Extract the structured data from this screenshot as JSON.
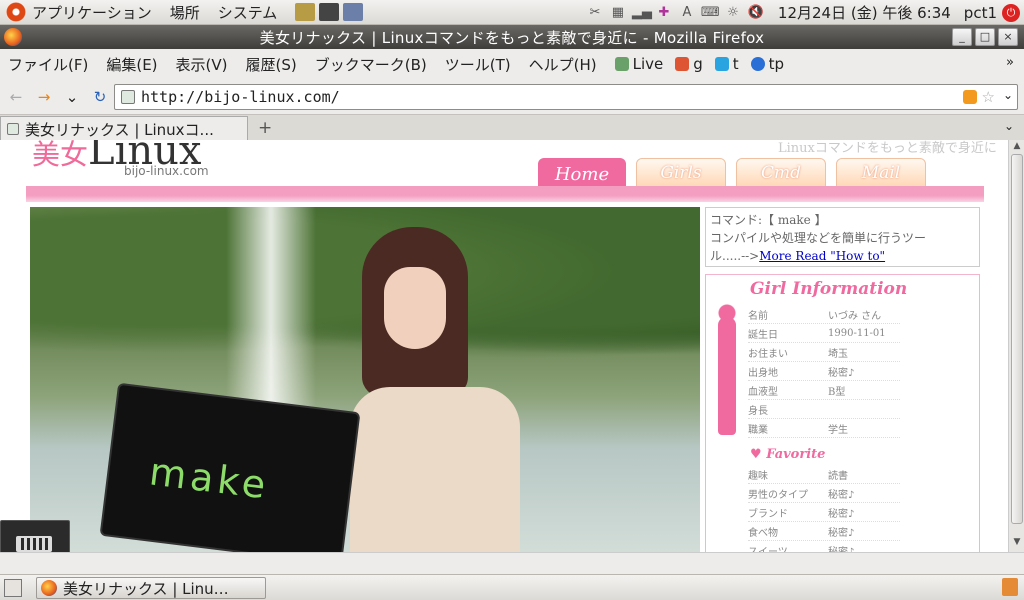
{
  "top_panel": {
    "menus": [
      "アプリケーション",
      "場所",
      "システム"
    ],
    "clock": "12月24日 (金) 午後 6:34",
    "user": "pct1"
  },
  "window": {
    "title": "美女リナックス | Linuxコマンドをもっと素敵で身近に - Mozilla Firefox",
    "buttons": [
      "_",
      "□",
      "×"
    ]
  },
  "menubar": {
    "items": [
      "ファイル(F)",
      "編集(E)",
      "表示(V)",
      "履歴(S)",
      "ブックマーク(B)",
      "ツール(T)",
      "ヘルプ(H)"
    ],
    "bookmarks": [
      {
        "label": "Live",
        "color": "#6aa06a"
      },
      {
        "label": "g",
        "color": "#d53"
      },
      {
        "label": "t",
        "color": "#2aa4e0"
      },
      {
        "label": "tp",
        "color": "#2a6fd6"
      }
    ],
    "more": "»"
  },
  "navbar": {
    "back": "←",
    "forward": "→",
    "history_drop": "⌄",
    "reload": "↻",
    "url": "http://bijo-linux.com/"
  },
  "tabbar": {
    "tab_label": "美女リナックス | Linuxコ...",
    "new_tab": "+",
    "list": "⌄"
  },
  "site": {
    "logo_main": "Linux",
    "logo_kanji": "美女",
    "logo_sub": "bijo-linux.com",
    "tagline": "Linuxコマンドをもっと素敵で身近に",
    "nav": [
      "Home",
      "Girls",
      "Cmd",
      "Mail"
    ],
    "board_text": "make",
    "command_box": {
      "line1": "コマンド:【 make 】",
      "line2": "コンパイルや処理などを簡単に行うツー",
      "line3": "ル.....-->",
      "link": "More Read \"How to\""
    },
    "info_title": "Girl Information",
    "info_rows": [
      {
        "k": "名前",
        "v": "いづみ さん"
      },
      {
        "k": "誕生日",
        "v": "1990-11-01"
      },
      {
        "k": "お住まい",
        "v": "埼玉"
      },
      {
        "k": "出身地",
        "v": "秘密♪"
      },
      {
        "k": "血液型",
        "v": "B型"
      },
      {
        "k": "身長",
        "v": ""
      },
      {
        "k": "職業",
        "v": "学生"
      }
    ],
    "favorite_title": "Favorite",
    "favorite_rows": [
      {
        "k": "趣味",
        "v": "読書"
      },
      {
        "k": "男性のタイプ",
        "v": "秘密♪"
      },
      {
        "k": "ブランド",
        "v": "秘密♪"
      },
      {
        "k": "食べ物",
        "v": "秘密♪"
      },
      {
        "k": "スイーツ",
        "v": "秘密♪"
      }
    ]
  },
  "taskbar": {
    "task_label": "美女リナックス | Linu…"
  }
}
